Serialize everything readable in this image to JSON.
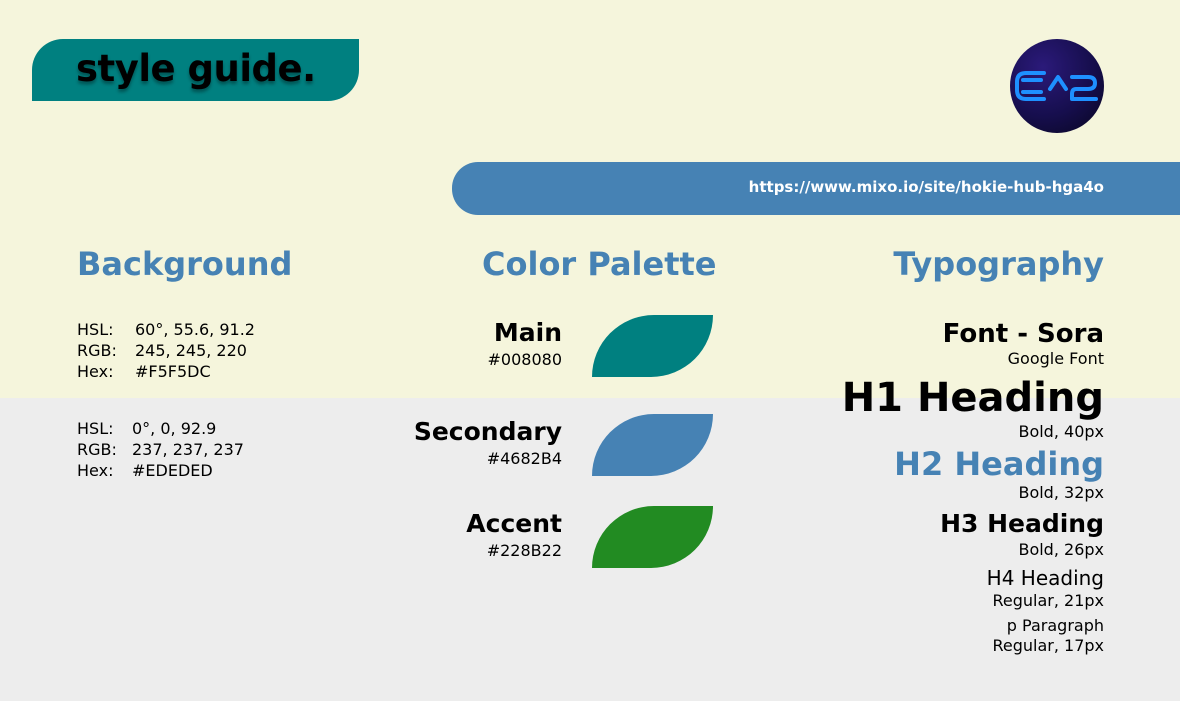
{
  "colors": {
    "background_top": "#F5F5DC",
    "background_bottom": "#EDEDED",
    "main": "#008080",
    "secondary": "#4682B4",
    "accent": "#228B22",
    "heading_blue": "#4682B4",
    "logo_glyph": "#1e90ff"
  },
  "header": {
    "title": "style guide.",
    "logo_icon": "ca2-logo",
    "url": "https://www.mixo.io/site/hokie-hub-hga4o"
  },
  "background_section": {
    "title": "Background",
    "primary": [
      {
        "key": "HSL:",
        "value": "60°, 55.6, 91.2"
      },
      {
        "key": "RGB:",
        "value": "245, 245, 220"
      },
      {
        "key": "Hex:",
        "value": "#F5F5DC"
      }
    ],
    "secondary": [
      {
        "key": "HSL:",
        "value": "0°, 0, 92.9"
      },
      {
        "key": "RGB:",
        "value": "237, 237, 237"
      },
      {
        "key": "Hex:",
        "value": "#EDEDED"
      }
    ]
  },
  "palette": {
    "title": "Color Palette",
    "items": [
      {
        "name": "Main",
        "hex": "#008080"
      },
      {
        "name": "Secondary",
        "hex": "#4682B4"
      },
      {
        "name": "Accent",
        "hex": "#228B22"
      }
    ]
  },
  "typography": {
    "title": "Typography",
    "font_name": "Font - Sora",
    "font_source": "Google Font",
    "h1": {
      "label": "H1 Heading",
      "spec": "Bold, 40px"
    },
    "h2": {
      "label": "H2 Heading",
      "spec": "Bold, 32px"
    },
    "h3": {
      "label": "H3 Heading",
      "spec": "Bold, 26px"
    },
    "h4": {
      "label": "H4 Heading",
      "spec": "Regular, 21px"
    },
    "p": {
      "label": "p Paragraph",
      "spec": "Regular, 17px"
    }
  }
}
